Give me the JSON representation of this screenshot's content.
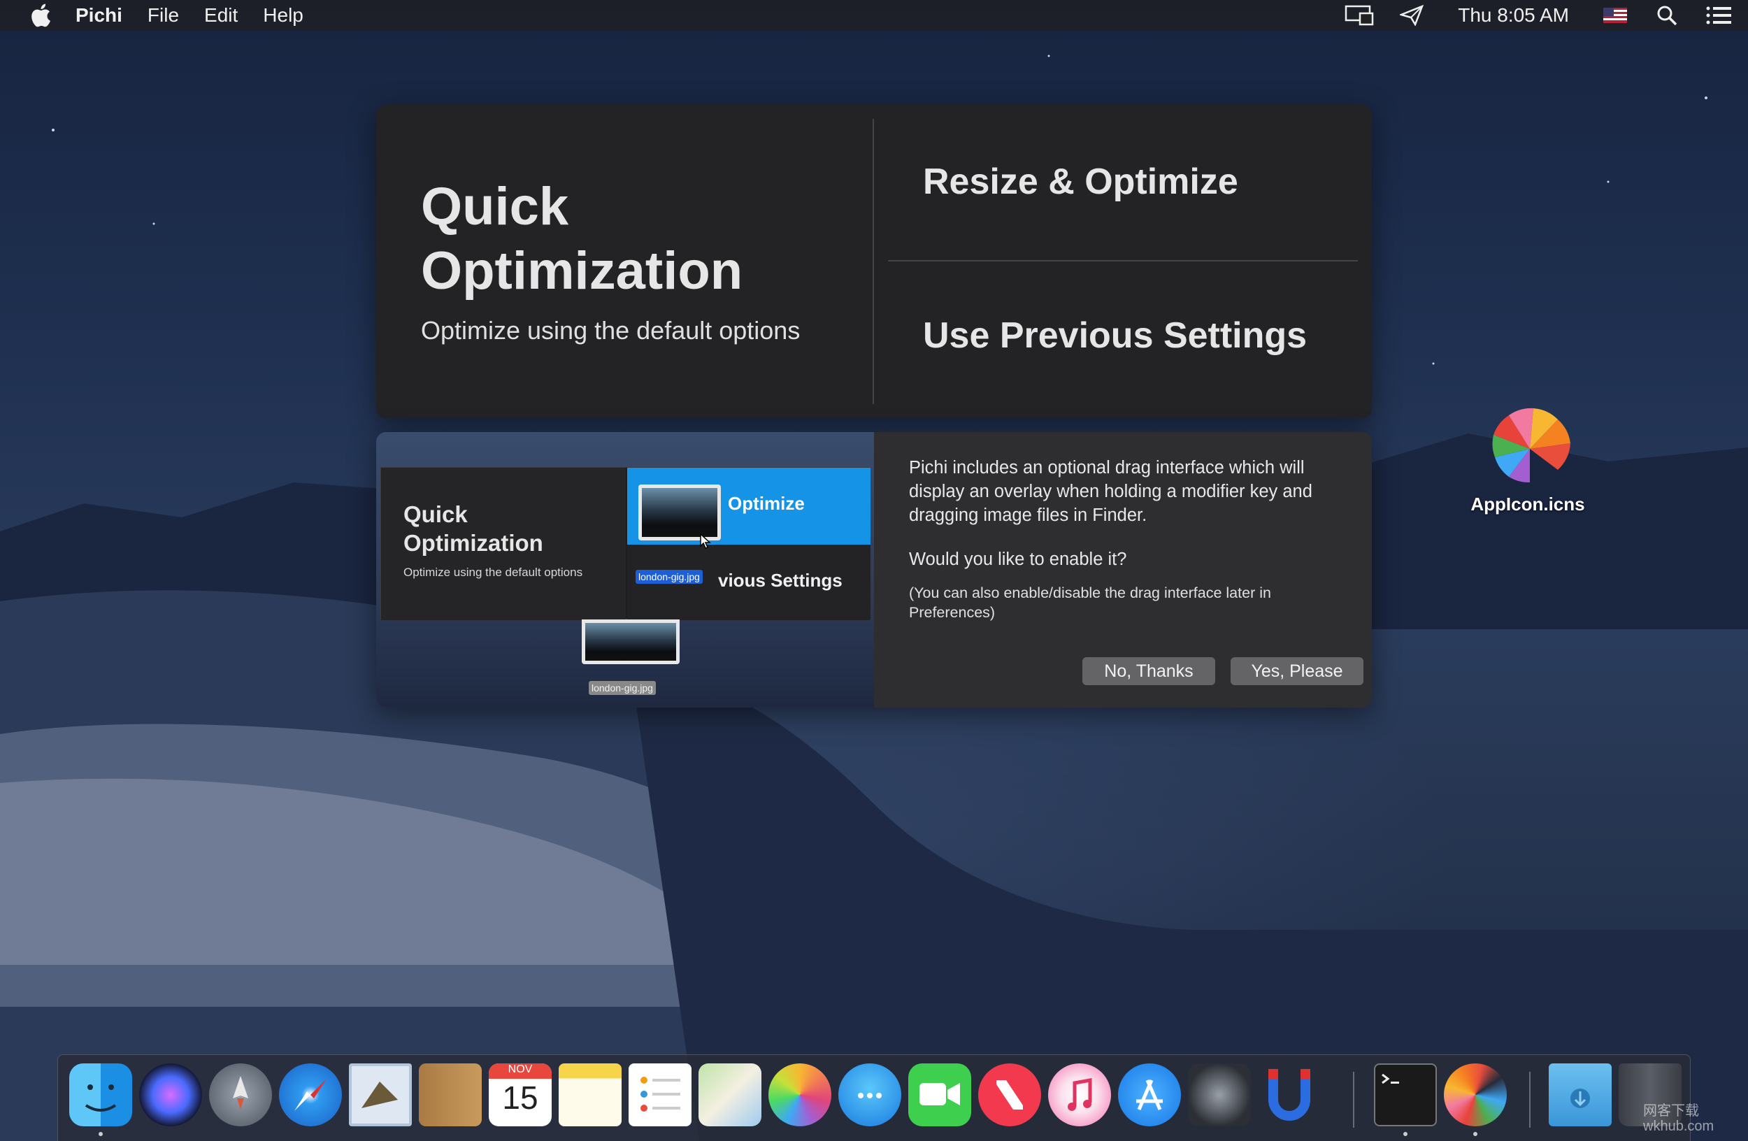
{
  "menubar": {
    "app_name": "Pichi",
    "menus": [
      "File",
      "Edit",
      "Help"
    ],
    "clock": "Thu 8:05 AM"
  },
  "quick_panel": {
    "title": "Quick Optimization",
    "subtitle": "Optimize using the default options",
    "resize_label": "Resize & Optimize",
    "previous_label": "Use Previous Settings"
  },
  "preview": {
    "mini_title": "Quick Optimization",
    "mini_subtitle": "Optimize using the default options",
    "mini_optimize": "Optimize",
    "mini_previous": "vious Settings",
    "file_name": "london-gig.jpg"
  },
  "dialog": {
    "message": "Pichi includes an optional drag interface which will display an overlay when holding a modifier key and dragging image files in Finder.",
    "question": "Would you like to enable it?",
    "note": "(You can also enable/disable the drag interface later in Preferences)",
    "no_label": "No, Thanks",
    "yes_label": "Yes, Please"
  },
  "desktop_icon": {
    "label": "AppIcon.icns"
  },
  "calendar": {
    "month": "NOV",
    "day": "15"
  },
  "dock_apps": [
    "finder",
    "siri",
    "launchpad",
    "safari",
    "mail",
    "contacts",
    "calendar",
    "notes",
    "reminders",
    "maps",
    "photos",
    "messages",
    "facetime",
    "news",
    "itunes",
    "app-store",
    "system-preferences",
    "magnet",
    "terminal",
    "pichi",
    "downloads",
    "trash"
  ],
  "watermark": [
    "网客下载",
    "wkhub.com"
  ],
  "colors": {
    "accent_blue": "#1593e6",
    "panel": "#232325",
    "dialog": "#2e2e30"
  }
}
